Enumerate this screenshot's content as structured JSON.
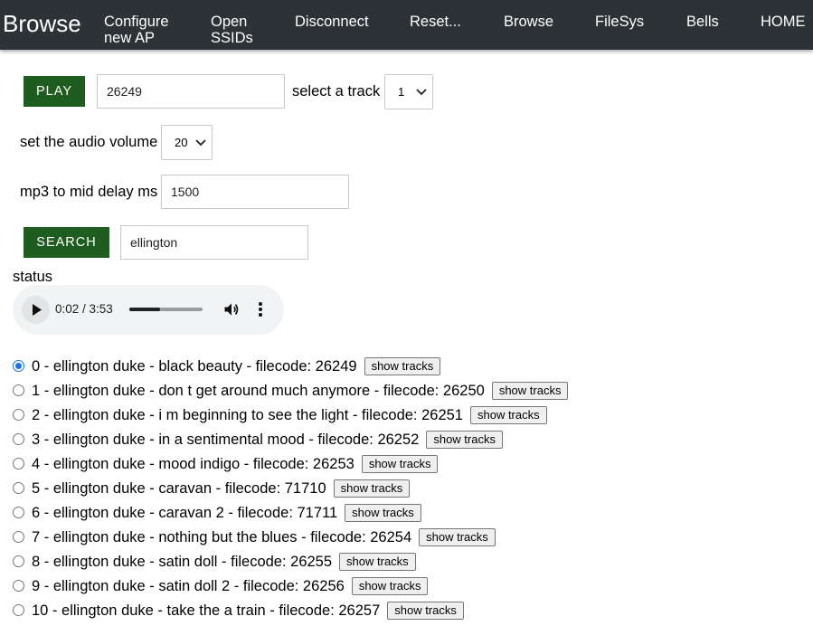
{
  "nav": {
    "brand": "Browse",
    "items": [
      {
        "line1": "Configure",
        "line2": "new AP"
      },
      {
        "line1": "Open",
        "line2": "SSIDs"
      },
      {
        "line1": "Disconnect",
        "line2": ""
      },
      {
        "line1": "Reset...",
        "line2": ""
      },
      {
        "line1": "Browse",
        "line2": ""
      },
      {
        "line1": "FileSys",
        "line2": ""
      },
      {
        "line1": "Bells",
        "line2": ""
      },
      {
        "line1": "HOME",
        "line2": ""
      }
    ]
  },
  "player": {
    "play_label": "PLAY",
    "filecode_value": "26249",
    "track_label": "select a track",
    "track_selected": "1"
  },
  "volume": {
    "label": "set the audio volume",
    "selected": "20"
  },
  "delay": {
    "label": "mp3 to mid delay ms",
    "value": "1500"
  },
  "search": {
    "button_label": "SEARCH",
    "value": "ellington"
  },
  "status": {
    "label": "status"
  },
  "audio": {
    "time_display": "0:02 / 3:53",
    "progress": 0.42
  },
  "results": {
    "button_label": "show tracks",
    "selected_index": 0,
    "items": [
      {
        "text": "0 - ellington duke - black beauty - filecode: 26249"
      },
      {
        "text": "1 - ellington duke - don t get around much anymore - filecode: 26250"
      },
      {
        "text": "2 - ellington duke - i m beginning to see the light - filecode: 26251"
      },
      {
        "text": "3 - ellington duke - in a sentimental mood - filecode: 26252"
      },
      {
        "text": "4 - ellington duke - mood indigo - filecode: 26253"
      },
      {
        "text": "5 - ellington duke - caravan - filecode: 71710"
      },
      {
        "text": "6 - ellington duke - caravan 2 - filecode: 71711"
      },
      {
        "text": "7 - ellington duke - nothing but the blues - filecode: 26254"
      },
      {
        "text": "8 - ellington duke - satin doll - filecode: 26255"
      },
      {
        "text": "9 - ellington duke - satin doll 2 - filecode: 26256"
      },
      {
        "text": "10 - ellington duke - take the a train - filecode: 26257"
      }
    ]
  },
  "colors": {
    "nav_bg": "#2d3236",
    "button_green": "#1e5d1f",
    "radio_accent": "#1a73e8"
  }
}
